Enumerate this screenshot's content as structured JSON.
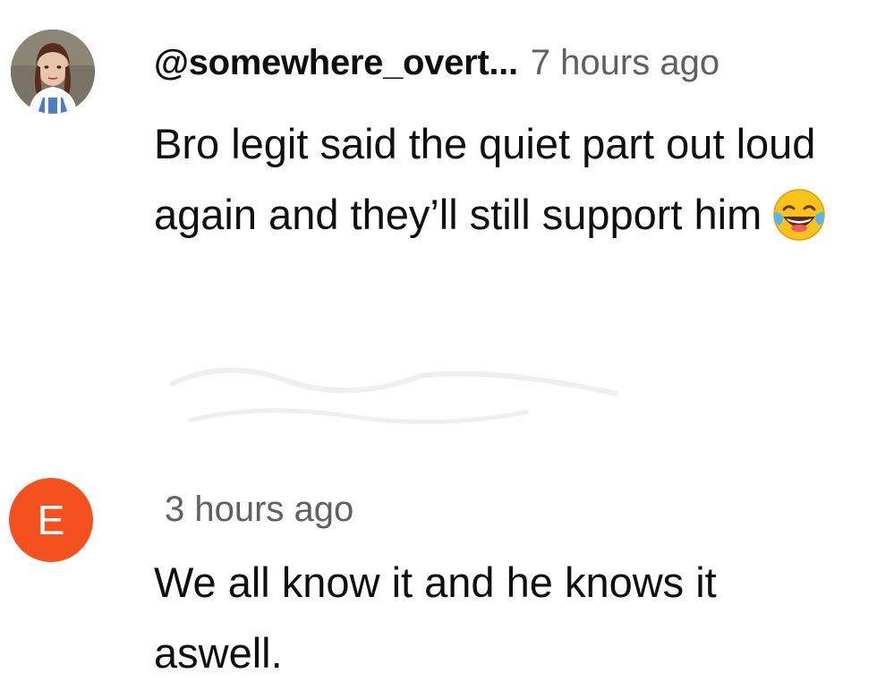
{
  "comments": [
    {
      "handle": "@somewhere_overt...",
      "timestamp": "7 hours ago",
      "text": "Bro legit said the quiet part out loud again and they’ll still support him",
      "emoji": "face-with-tears-of-joy-icon",
      "avatar": "profile-photo"
    },
    {
      "avatar_letter": "E",
      "avatar_color": "#f4511e",
      "timestamp": "3 hours ago",
      "text": "We all know it and he knows it aswell."
    }
  ],
  "colors": {
    "text": "#0f0f0f",
    "muted": "#606060",
    "background": "#ffffff"
  }
}
